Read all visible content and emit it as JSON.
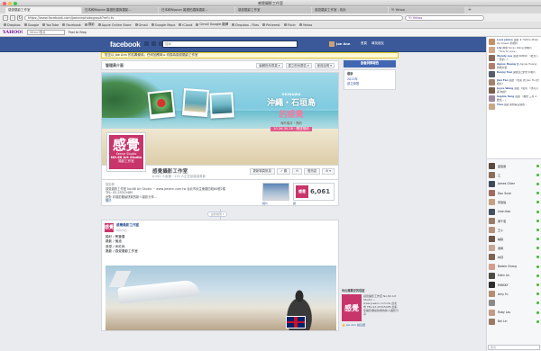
{
  "window": {
    "title": "感覺攝影工作室"
  },
  "tabs": [
    "感覺攝影工作室",
    "日本和Nippon 婚禮拍攝與攝影...",
    "日本和Nippon 婚禮拍攝與攝影...",
    "感覺攝影工作室",
    "感覺攝影工作室 - 相片",
    "Y! Yahoo"
  ],
  "toolbar": {
    "url": "https://www.facebook.com/joeannphotograph?ref=ts",
    "search": "Y! Yahoo"
  },
  "bookmarks": [
    "Dropbox",
    "Google",
    "YouTube",
    "Facebook",
    "攝影",
    "Apple Online Store",
    "Gmail",
    "Google Maps",
    "iCloud",
    "Gmail Google 翻譯",
    "Dropbox - Files",
    "Pinterest",
    "Flickr",
    "Yahoo"
  ],
  "yahoo_bar": {
    "logo": "YAHOO!",
    "search_placeholder": "Yahoo!搜尋",
    "items": [
      "Pool to Blog"
    ]
  },
  "facebook": {
    "logo": "facebook",
    "search_placeholder": "搜尋",
    "user": "Joe Ann",
    "nav": [
      "首頁",
      "尋找朋友"
    ],
    "notice": "您正以 Joe Ann 的名義使用。任何回應時 ▸ 切換為感覺攝影工作室",
    "admin": {
      "title": "管理員介面",
      "buttons": [
        "編輯粉絲專頁 ▾",
        "建立粉絲廣告 ▾",
        "使用說明 ▾"
      ]
    },
    "cover": {
      "sub": "OKINAWA",
      "line1": "沖繩・石垣島",
      "line2": "的感覺",
      "tag": "海外蜜月・預約",
      "date": "10.26-30.28・開放預約"
    },
    "profile": {
      "big": "感覺",
      "sm": "Sense Studio",
      "studio": "NO.66 Art Studio",
      "label": "攝影工作室"
    },
    "page_name": "感覺攝影工作室",
    "page_stats": "6,061 人說讚 · 225 人正在談論這專頁",
    "actions": [
      "更新專頁訊息",
      "✓ 讚",
      "✉",
      "發訊息",
      "⚙ ▾"
    ],
    "info": {
      "category": "攝影師",
      "line1": "感覺攝影工作室 No.66 Art Studio ~ www.joeann.com.tw 台北市民生東路四段60號2樓",
      "line2": "TEL: 02-25315485",
      "line3": "此對 拿攝影棚最快樂的新人攝影分享...",
      "more": "關於",
      "photos_label": "相片",
      "likes": "6,061",
      "likes_label": "讚"
    },
    "timeline_pill": "最新動態 ▾",
    "post": {
      "author": "感覺攝影工作室",
      "time": "8月29日 ·",
      "lines": [
        "婚紗 / 黑筆攤",
        "攝影 / 蒐迪",
        "造型 / 米紅絲",
        "攝影 / 感覺攝影工作室"
      ]
    },
    "side": {
      "button": "查看洞察報告",
      "nav": [
        "最新",
        "2013年",
        "創立時間"
      ]
    },
    "ad": {
      "title": "你反應最受的程度",
      "img": "感覺",
      "text": "感覺攝影工作室 No.66 Art Studio ~ www.joeann.com.tw 台北市 TEL:02-25315485 此對 拿攝影棚最快樂的新人攝影分享",
      "like": "👍 Joe Ann 說這讚"
    }
  },
  "chat": {
    "ticker": [
      {
        "name": "Love Janice",
        "text": "說讚 ★ HeShe Make Up Queen 的相片",
        "color": "#c4906a"
      },
      {
        "name": "Lily",
        "text": "剛剛 Soren Wang 的相片 「How To Love」",
        "color": "#d2a88a"
      },
      {
        "name": "Wendy Lee",
        "text": "說讚 KKBOX 《聽見下一首的...》",
        "color": "#8b6b55"
      },
      {
        "name": "Agnes Huang",
        "text": "在 Agnes Huang 的相片讚",
        "color": "#b07e6e"
      },
      {
        "name": "Kenny Tsai",
        "text": "說讚自己的分享相片",
        "color": "#555e6a"
      },
      {
        "name": "Jian Fan",
        "text": "說讚 《知名 的 Jian Hu 的相片》",
        "color": "#a3826b"
      },
      {
        "name": "Joyce Wang",
        "text": "說讚 《如何 《也可以講 你的》",
        "color": "#7a5d4a"
      },
      {
        "name": "Sophie Tang",
        "text": "說讚 「聯想 三星 A 數位...」",
        "color": "#9c8aa3"
      },
      {
        "name": "Tina",
        "text": "說讚 我想看這個的...",
        "color": "#c9a886"
      }
    ],
    "friends": [
      {
        "name": "康嘉豪",
        "color": "#5b4a3c"
      },
      {
        "name": "江",
        "color": "#8c6d57"
      },
      {
        "name": "James Chien",
        "color": "#3e4a5c"
      },
      {
        "name": "Dou Suve",
        "color": "#a36b5d"
      },
      {
        "name": "郭嘉儀",
        "color": "#c8a07f"
      },
      {
        "name": "Leon Kao",
        "color": "#44505e"
      },
      {
        "name": "黃千若",
        "color": "#9a7c66"
      },
      {
        "name": "王小",
        "color": "#b8927c"
      },
      {
        "name": "楊毅",
        "color": "#6e5545"
      },
      {
        "name": "吳佩",
        "color": "#c7a693"
      },
      {
        "name": "林芬",
        "color": "#7f6250"
      },
      {
        "name": "Barbie Chang",
        "color": "#d39d89"
      },
      {
        "name": "Eden Lin",
        "color": "#4f4a45"
      },
      {
        "name": "MINSKY",
        "color": "#2f2f2f"
      },
      {
        "name": "Amy Fu",
        "color": "#b88c70"
      },
      {
        "name": "",
        "color": "#8a8a8a"
      },
      {
        "name": "Ruby Lau",
        "color": "#c29a86"
      },
      {
        "name": "Bel Lin",
        "color": "#9b7a64"
      }
    ],
    "search_placeholder": "搜尋"
  }
}
